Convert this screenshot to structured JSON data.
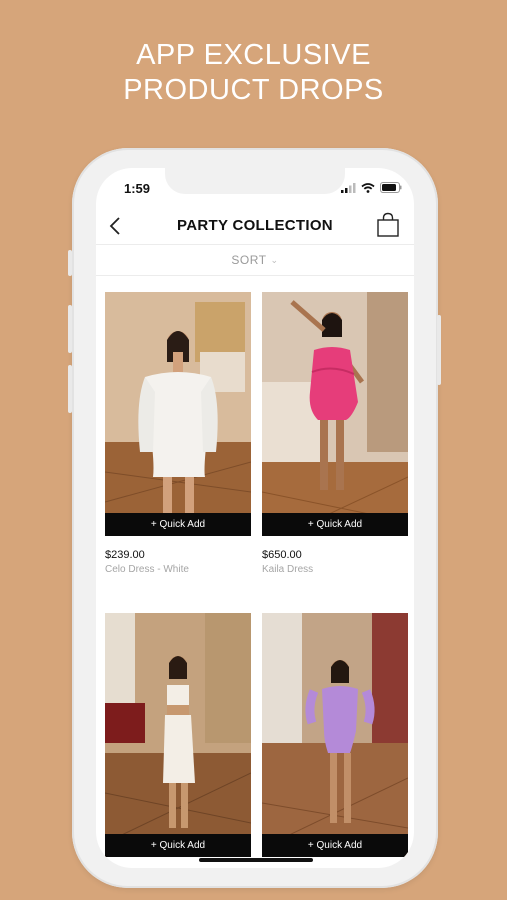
{
  "promo": {
    "line1": "APP EXCLUSIVE",
    "line2": "PRODUCT DROPS"
  },
  "status_bar": {
    "time": "1:59"
  },
  "nav": {
    "title": "PARTY COLLECTION"
  },
  "sort": {
    "label": "SORT"
  },
  "products": [
    {
      "price": "$239.00",
      "name": "Celo Dress - White",
      "quick_add": "+ Quick Add",
      "dress_color": "#f4f2ee"
    },
    {
      "price": "$650.00",
      "name": "Kaila Dress",
      "quick_add": "+ Quick Add",
      "dress_color": "#e63d7a"
    },
    {
      "price": "",
      "name": "",
      "quick_add": "+ Quick Add",
      "dress_color": "#f3eee6"
    },
    {
      "price": "",
      "name": "",
      "quick_add": "+ Quick Add",
      "dress_color": "#b48ad8"
    }
  ],
  "colors": {
    "background": "#d6a57a",
    "accent": "#0a0a0a",
    "muted_text": "#a5a5a5"
  }
}
